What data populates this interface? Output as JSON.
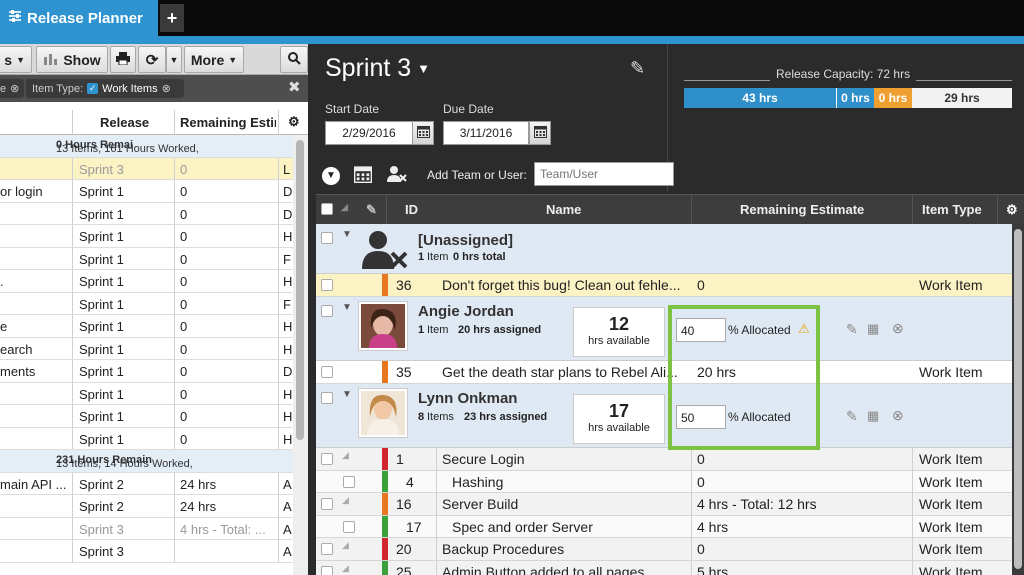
{
  "app": {
    "tab_title": "Release Planner",
    "new_tab": "+"
  },
  "left": {
    "toolbar": {
      "partial": "s",
      "show": "Show",
      "more": "More"
    },
    "filter": {
      "partial": "e",
      "type_label": "Item Type:",
      "chip": "Work Items"
    },
    "headers": {
      "release": "Release",
      "remaining": "Remaining Estim"
    },
    "group1": {
      "prefix": "13 Items, 161 Hours Worked, ",
      "bold": "0 Hours Remai"
    },
    "group2": {
      "prefix": "13 Items, 14 Hours Worked, ",
      "bold": "231 Hours Remain"
    },
    "rows1": [
      {
        "name": "",
        "release": "Sprint 3",
        "rem": "0",
        "tail": "L"
      },
      {
        "name": "or login",
        "release": "Sprint 1",
        "rem": "0",
        "tail": "D"
      },
      {
        "name": "",
        "release": "Sprint 1",
        "rem": "0",
        "tail": "D"
      },
      {
        "name": "",
        "release": "Sprint 1",
        "rem": "0",
        "tail": "H"
      },
      {
        "name": "",
        "release": "Sprint 1",
        "rem": "0",
        "tail": "F"
      },
      {
        "name": ".",
        "release": "Sprint 1",
        "rem": "0",
        "tail": "H"
      },
      {
        "name": "",
        "release": "Sprint 1",
        "rem": "0",
        "tail": "F"
      },
      {
        "name": "e",
        "release": "Sprint 1",
        "rem": "0",
        "tail": "H"
      },
      {
        "name": "earch",
        "release": "Sprint 1",
        "rem": "0",
        "tail": "H"
      },
      {
        "name": "ments",
        "release": "Sprint 1",
        "rem": "0",
        "tail": "D"
      },
      {
        "name": "",
        "release": "Sprint 1",
        "rem": "0",
        "tail": "H"
      },
      {
        "name": "",
        "release": "Sprint 1",
        "rem": "0",
        "tail": "H"
      },
      {
        "name": "",
        "release": "Sprint 1",
        "rem": "0",
        "tail": "H"
      }
    ],
    "rows2": [
      {
        "name": "main API ...",
        "release": "Sprint 2",
        "rem": "24 hrs",
        "tail": "A"
      },
      {
        "name": "",
        "release": "Sprint 2",
        "rem": "24 hrs",
        "tail": "A"
      },
      {
        "name": "",
        "release": "Sprint 3",
        "rem": "4 hrs - Total: ...",
        "tail": "A"
      },
      {
        "name": "",
        "release": "Sprint 3",
        "rem": "",
        "tail": "A"
      }
    ]
  },
  "sprint": {
    "title": "Sprint 3",
    "start_label": "Start Date",
    "start_value": "2/29/2016",
    "due_label": "Due Date",
    "due_value": "3/11/2016"
  },
  "capacity": {
    "label": "Release Capacity: 72 hrs",
    "segments": [
      "43 hrs",
      "0 hrs",
      "0 hrs",
      "29 hrs"
    ],
    "colors": {
      "blue": "#2f8fc9",
      "orange": "#f0a030",
      "white": "#f2f2f2"
    }
  },
  "team": {
    "label": "Add Team or User:",
    "placeholder": "Team/User"
  },
  "grid": {
    "headers": {
      "id": "ID",
      "name": "Name",
      "remaining": "Remaining Estimate",
      "type": "Item Type"
    },
    "unassigned": {
      "name": "[Unassigned]",
      "count": "1",
      "count_label": "Item",
      "hrs": "0 hrs total"
    },
    "unassigned_row": {
      "id": "36",
      "name": "Don't forget this bug! Clean out fehle...",
      "rem": "0",
      "type": "Work Item"
    },
    "users": [
      {
        "name": "Angie Jordan",
        "count": "1",
        "count_label": "Item",
        "hrs": "20 hrs assigned",
        "avail_num": "12",
        "avail_label": "hrs available",
        "percent": "40",
        "alloc_label": "% Allocated"
      },
      {
        "name": "Lynn Onkman",
        "count": "8",
        "count_label": "Items",
        "hrs": "23 hrs assigned",
        "avail_num": "17",
        "avail_label": "hrs available",
        "percent": "50",
        "alloc_label": "% Allocated"
      }
    ],
    "angie_row": {
      "id": "35",
      "name": "Get the death star plans to Rebel Ali...",
      "rem": "20 hrs",
      "type": "Work Item"
    },
    "lynn_rows": [
      {
        "id": "1",
        "name": "Secure Login",
        "rem": "0",
        "type": "Work Item"
      },
      {
        "id": "4",
        "name": "Hashing",
        "rem": "0",
        "type": "Work Item"
      },
      {
        "id": "16",
        "name": "Server Build",
        "rem": "4 hrs - Total: 12 hrs",
        "type": "Work Item"
      },
      {
        "id": "17",
        "name": "Spec and order Server",
        "rem": "4 hrs",
        "type": "Work Item"
      },
      {
        "id": "20",
        "name": "Backup Procedures",
        "rem": "0",
        "type": "Work Item"
      },
      {
        "id": "25",
        "name": "Admin Button added to all pages",
        "rem": "5 hrs",
        "type": "Work Item"
      }
    ]
  }
}
